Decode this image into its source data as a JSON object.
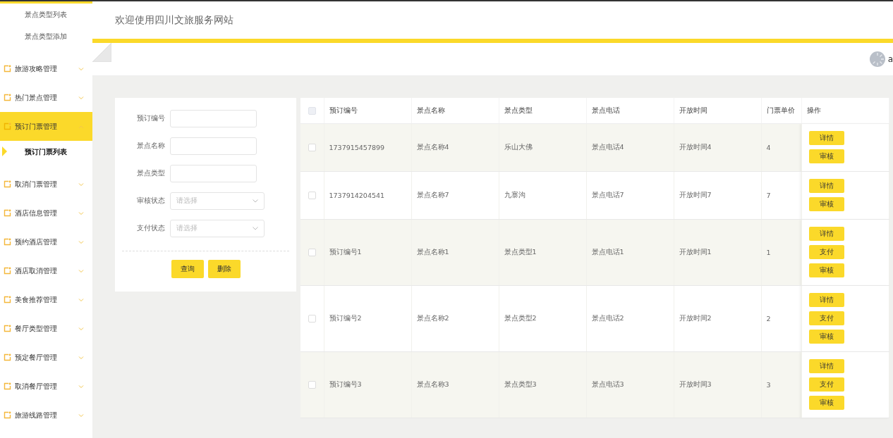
{
  "header": {
    "title": "欢迎使用四川文旅服务网站",
    "user": "a"
  },
  "sidebar": {
    "items": [
      {
        "label": "景点类型列表",
        "kind": "sub",
        "selected": false
      },
      {
        "label": "景点类型添加",
        "kind": "sub",
        "selected": false
      },
      {
        "label": "旅游攻略管理",
        "kind": "group",
        "expanded": false,
        "selected": false
      },
      {
        "label": "热门景点管理",
        "kind": "group",
        "expanded": false,
        "selected": false
      },
      {
        "label": "预订门票管理",
        "kind": "group",
        "expanded": true,
        "selected": true
      },
      {
        "label": "预订门票列表",
        "kind": "sub",
        "selected": true
      },
      {
        "label": "取消门票管理",
        "kind": "group",
        "expanded": false,
        "selected": false
      },
      {
        "label": "酒店信息管理",
        "kind": "group",
        "expanded": false,
        "selected": false
      },
      {
        "label": "预约酒店管理",
        "kind": "group",
        "expanded": false,
        "selected": false
      },
      {
        "label": "酒店取消管理",
        "kind": "group",
        "expanded": false,
        "selected": false
      },
      {
        "label": "美食推荐管理",
        "kind": "group",
        "expanded": false,
        "selected": false
      },
      {
        "label": "餐厅类型管理",
        "kind": "group",
        "expanded": false,
        "selected": false
      },
      {
        "label": "预定餐厅管理",
        "kind": "group",
        "expanded": false,
        "selected": false
      },
      {
        "label": "取消餐厅管理",
        "kind": "group",
        "expanded": false,
        "selected": false
      },
      {
        "label": "旅游线路管理",
        "kind": "group",
        "expanded": false,
        "selected": false
      }
    ]
  },
  "search": {
    "fields": [
      {
        "label": "预订编号",
        "kind": "text"
      },
      {
        "label": "景点名称",
        "kind": "text"
      },
      {
        "label": "景点类型",
        "kind": "text"
      },
      {
        "label": "审核状态",
        "kind": "select",
        "placeholder": "请选择"
      },
      {
        "label": "支付状态",
        "kind": "select",
        "placeholder": "请选择"
      }
    ],
    "buttons": [
      "查询",
      "删除"
    ]
  },
  "table": {
    "select_all": {
      "checked": false
    },
    "columns": [
      "预订编号",
      "景点名称",
      "景点类型",
      "景点电话",
      "开放时间",
      "门票单价",
      "操作"
    ],
    "rows": [
      {
        "checked": false,
        "cells": [
          "1737915457899",
          "景点名称4",
          "乐山大佛",
          "景点电话4",
          "开放时间4",
          "4"
        ],
        "actions": [
          "详情",
          "审核"
        ]
      },
      {
        "checked": false,
        "cells": [
          "1737914204541",
          "景点名称7",
          "九寨沟",
          "景点电话7",
          "开放时间7",
          "7"
        ],
        "actions": [
          "详情",
          "审核"
        ]
      },
      {
        "checked": false,
        "cells": [
          "预订编号1",
          "景点名称1",
          "景点类型1",
          "景点电话1",
          "开放时间1",
          "1"
        ],
        "actions": [
          "详情",
          "支付",
          "审核"
        ]
      },
      {
        "checked": false,
        "cells": [
          "预订编号2",
          "景点名称2",
          "景点类型2",
          "景点电话2",
          "开放时间2",
          "2"
        ],
        "actions": [
          "详情",
          "支付",
          "审核"
        ]
      },
      {
        "checked": false,
        "cells": [
          "预订编号3",
          "景点名称3",
          "景点类型3",
          "景点电话3",
          "开放时间3",
          "3"
        ],
        "actions": [
          "详情",
          "支付",
          "审核"
        ]
      }
    ]
  }
}
